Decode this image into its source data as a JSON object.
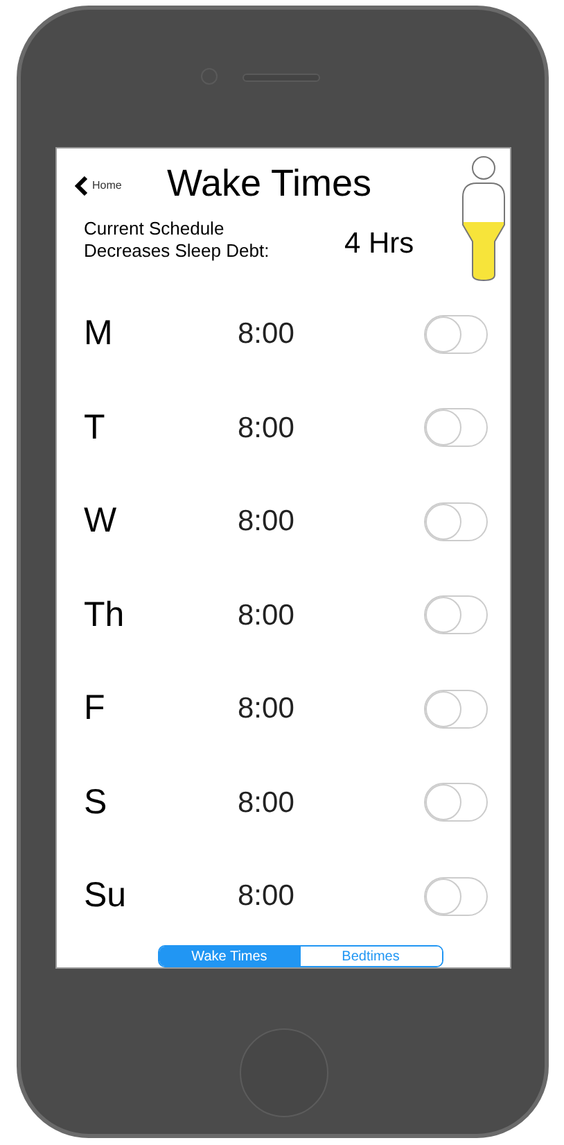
{
  "header": {
    "back_label": "Home",
    "title": "Wake Times",
    "summary_label": "Current Schedule Decreases Sleep Debt:",
    "summary_value": "4 Hrs"
  },
  "days": [
    {
      "day": "M",
      "time": "8:00",
      "on": false
    },
    {
      "day": "T",
      "time": "8:00",
      "on": false
    },
    {
      "day": "W",
      "time": "8:00",
      "on": false
    },
    {
      "day": "Th",
      "time": "8:00",
      "on": false
    },
    {
      "day": "F",
      "time": "8:00",
      "on": false
    },
    {
      "day": "S",
      "time": "8:00",
      "on": false
    },
    {
      "day": "Su",
      "time": "8:00",
      "on": false
    }
  ],
  "tabs": [
    {
      "label": "Wake Times",
      "selected": true
    },
    {
      "label": "Bedtimes",
      "selected": false
    }
  ]
}
